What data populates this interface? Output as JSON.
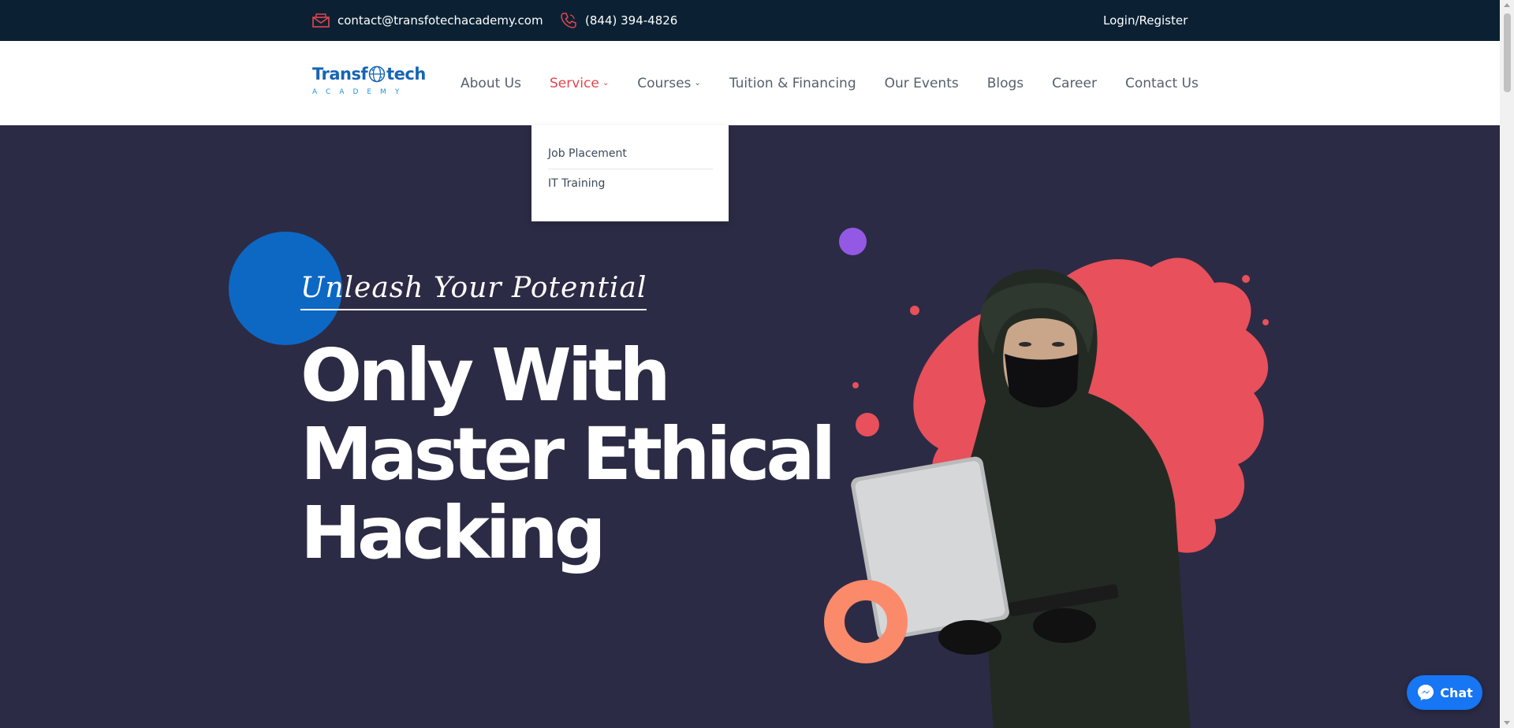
{
  "topbar": {
    "email": "contact@transfotechacademy.com",
    "phone": "(844) 394-4826",
    "login": "Login/Register",
    "email_icon": "envelope-icon",
    "phone_icon": "phone-icon"
  },
  "logo": {
    "word_left": "Transf",
    "word_right": "tech",
    "sub": "ACADEMY"
  },
  "nav": {
    "items": [
      {
        "label": "About Us"
      },
      {
        "label": "Service",
        "active": true
      },
      {
        "label": "Courses"
      },
      {
        "label": "Tuition & Financing"
      },
      {
        "label": "Our Events"
      },
      {
        "label": "Blogs"
      },
      {
        "label": "Career"
      },
      {
        "label": "Contact Us"
      }
    ]
  },
  "dropdown": {
    "items": [
      "Job Placement",
      "IT Training"
    ]
  },
  "hero": {
    "tagline": "Unleash Your Potential",
    "headline": [
      "Only With",
      "Master Ethical",
      "Hacking"
    ]
  },
  "chat": {
    "label": "Chat",
    "icon": "messenger-icon"
  },
  "colors": {
    "topbar": "#0b2133",
    "accent": "#e3464d",
    "hero_bg": "#2c2b45",
    "brand_blue": "#1664b4",
    "splash": "#e8505b",
    "ring": "#fa8a6a"
  }
}
